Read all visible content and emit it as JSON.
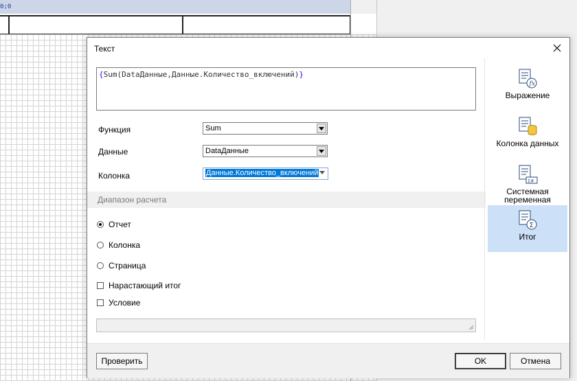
{
  "background": {
    "ruler_text": "0;0"
  },
  "dialog": {
    "title": "Текст",
    "expression": {
      "open_brace": "{",
      "body": "Sum(DataДанные,Данные.Количество_включений)",
      "close_brace": "}"
    },
    "fields": {
      "function_label": "Функция",
      "function_value": "Sum",
      "data_label": "Данные",
      "data_value": "DataДанные",
      "column_label": "Колонка",
      "column_value": "Данные.Количество_включений"
    },
    "range_section": {
      "title": "Диапазон расчета",
      "options": [
        {
          "label": "Отчет",
          "selected": true
        },
        {
          "label": "Колонка",
          "selected": false
        },
        {
          "label": "Страница",
          "selected": false
        }
      ]
    },
    "checkboxes": {
      "running_total": {
        "label": "Нарастающий итог",
        "checked": false
      },
      "condition": {
        "label": "Условие",
        "checked": false
      }
    },
    "buttons": {
      "check": "Проверить",
      "ok": "OK",
      "cancel": "Отмена"
    },
    "side_panel": {
      "items": [
        {
          "label": "Выражение",
          "icon": "expression-icon",
          "active": false
        },
        {
          "label": "Колонка данных",
          "icon": "data-column-icon",
          "active": false
        },
        {
          "label": "Системная переменная",
          "icon": "system-variable-icon",
          "active": false
        },
        {
          "label": "Итог",
          "icon": "summary-icon",
          "active": true
        }
      ]
    }
  },
  "colors": {
    "accent": "#0078d7",
    "active_side": "#cce0f7",
    "brace": "#1a1aff"
  }
}
